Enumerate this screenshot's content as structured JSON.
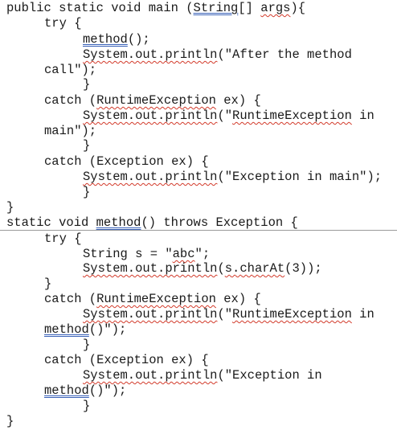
{
  "document": {
    "lines": [
      {
        "pre": "public static void main (",
        "dbl": "String",
        "mid": "[] ",
        "sq": "args",
        "post": "){"
      },
      {
        "text": "try {"
      },
      {
        "dbl": "method",
        "post": "();"
      },
      {
        "sq": "System.out.println",
        "post": "(\"After the method"
      },
      {
        "text": "call\");"
      },
      {
        "text": "}"
      },
      {
        "pre": "catch (",
        "sq": "RuntimeException",
        "post": " ex) {"
      },
      {
        "sq": "System.out.println",
        "mid": "(\"",
        "sq2": "RuntimeException",
        "post": " in"
      },
      {
        "text": "main\");"
      },
      {
        "text": "}"
      },
      {
        "text": "catch (Exception ex) {"
      },
      {
        "sq": "System.out.println",
        "post": "(\"Exception in main\");"
      },
      {
        "text": "}"
      },
      {
        "text": "}"
      },
      {
        "pre": "static void ",
        "dbl": "method",
        "post": "() throws Exception {"
      },
      {
        "text": "try {"
      },
      {
        "pre": "String s = \"",
        "sq": "abc",
        "post": "\";"
      },
      {
        "sq": "System.out.println",
        "mid": "(",
        "sq2": "s.charAt",
        "post": "(3));"
      },
      {
        "text": "}"
      },
      {
        "pre": "catch (",
        "sq": "RuntimeException",
        "post": " ex) {"
      },
      {
        "sq": "System.out.println",
        "mid": "(\"",
        "sq2": "RuntimeException",
        "post": " in"
      },
      {
        "dbl": "method",
        "post": "()\");"
      },
      {
        "text": "}"
      },
      {
        "text": "catch (Exception ex) {"
      },
      {
        "sq": "System.out.println",
        "post": "(\"Exception in"
      },
      {
        "dbl": "method",
        "post": "()\");"
      },
      {
        "text": "}"
      },
      {
        "text": "}"
      }
    ]
  },
  "colors": {
    "spell_squiggle": "#d23a2a",
    "grammar_double_underline": "#3a62b8"
  }
}
